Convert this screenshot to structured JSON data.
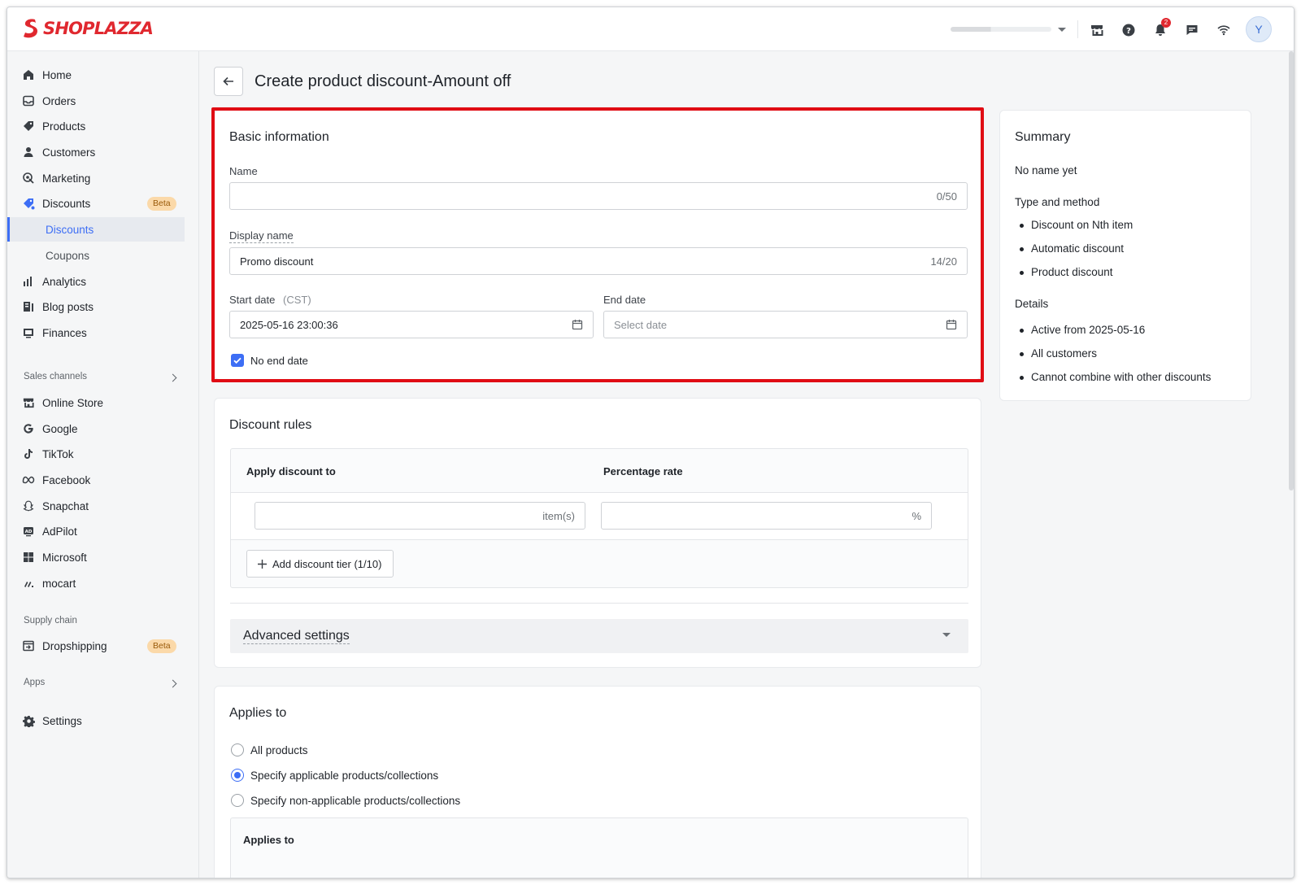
{
  "brand": {
    "name": "SHOPLAZZA",
    "accent": "#e0282f",
    "primary": "#3d6ef5",
    "highlight": "#e00c14"
  },
  "topbar": {
    "notifications_count": "2",
    "avatar_initial": "Y",
    "icons": [
      "store-icon",
      "help-icon",
      "bell-icon",
      "message-icon",
      "wifi-icon"
    ]
  },
  "sidebar": {
    "items": [
      {
        "label": "Home",
        "icon": "home-icon"
      },
      {
        "label": "Orders",
        "icon": "orders-icon"
      },
      {
        "label": "Products",
        "icon": "tag-icon"
      },
      {
        "label": "Customers",
        "icon": "person-icon"
      },
      {
        "label": "Marketing",
        "icon": "marketing-icon"
      },
      {
        "label": "Discounts",
        "icon": "discount-icon",
        "badge": "Beta"
      },
      {
        "label": "Discounts",
        "sub": true,
        "active": true
      },
      {
        "label": "Coupons",
        "sub": true
      },
      {
        "label": "Analytics",
        "icon": "chart-icon"
      },
      {
        "label": "Blog posts",
        "icon": "blog-icon"
      },
      {
        "label": "Finances",
        "icon": "finances-icon"
      }
    ],
    "sales_channels_label": "Sales channels",
    "channels": [
      {
        "label": "Online Store",
        "icon": "store-icon"
      },
      {
        "label": "Google",
        "icon": "google-icon"
      },
      {
        "label": "TikTok",
        "icon": "tiktok-icon"
      },
      {
        "label": "Facebook",
        "icon": "meta-icon"
      },
      {
        "label": "Snapchat",
        "icon": "snapchat-icon"
      },
      {
        "label": "AdPilot",
        "icon": "adpilot-icon"
      },
      {
        "label": "Microsoft",
        "icon": "microsoft-icon"
      },
      {
        "label": "mocart",
        "icon": "mocart-icon"
      }
    ],
    "supply_chain_label": "Supply chain",
    "dropshipping": {
      "label": "Dropshipping",
      "badge": "Beta"
    },
    "apps_label": "Apps",
    "settings_label": "Settings"
  },
  "page": {
    "title": "Create product discount-Amount off"
  },
  "basic": {
    "title": "Basic information",
    "name_label": "Name",
    "name_value": "",
    "name_count": "0/50",
    "display_label": "Display name",
    "display_value": "Promo discount",
    "display_count": "14/20",
    "start_label": "Start date",
    "start_tz": "(CST)",
    "start_value": "2025-05-16 23:00:36",
    "end_label": "End date",
    "end_placeholder": "Select date",
    "no_end_label": "No end date",
    "no_end_checked": true
  },
  "rules": {
    "title": "Discount rules",
    "col_apply": "Apply discount to",
    "col_rate": "Percentage rate",
    "items_suffix": "item(s)",
    "rate_suffix": "%",
    "add_tier_label": "Add discount tier (1/10)",
    "advanced_label": "Advanced settings"
  },
  "applies": {
    "title": "Applies to",
    "options": [
      "All products",
      "Specify applicable products/collections",
      "Specify non-applicable products/collections"
    ],
    "selected": 1,
    "sub_title": "Applies to"
  },
  "summary": {
    "title": "Summary",
    "name_state": "No name yet",
    "type_heading": "Type and method",
    "type_items": [
      "Discount on Nth item",
      "Automatic discount",
      "Product discount"
    ],
    "details_heading": "Details",
    "details_items": [
      "Active from 2025-05-16",
      "All customers",
      "Cannot combine with other discounts"
    ]
  }
}
